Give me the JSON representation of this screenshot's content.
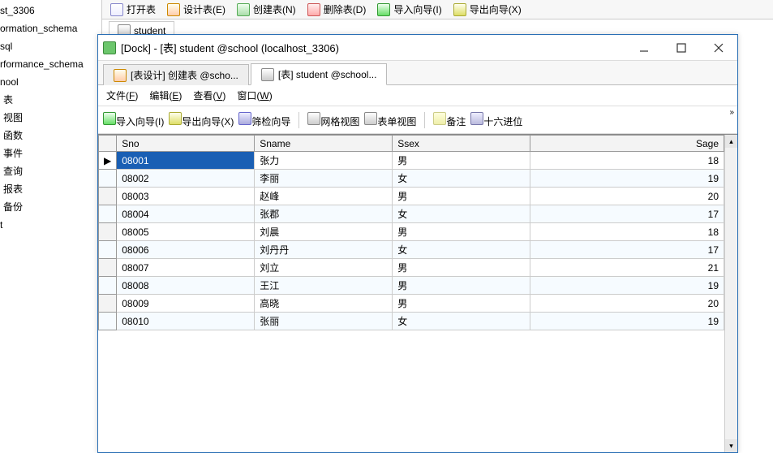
{
  "tree": {
    "items": [
      {
        "label": "st_3306",
        "lvl": 1
      },
      {
        "label": "ormation_schema",
        "lvl": 1
      },
      {
        "label": "sql",
        "lvl": 1
      },
      {
        "label": "rformance_schema",
        "lvl": 1
      },
      {
        "label": "nool",
        "lvl": 1
      },
      {
        "label": "表",
        "lvl": 2
      },
      {
        "label": "视图",
        "lvl": 2
      },
      {
        "label": "函数",
        "lvl": 2
      },
      {
        "label": "事件",
        "lvl": 2
      },
      {
        "label": "查询",
        "lvl": 2
      },
      {
        "label": "报表",
        "lvl": 2
      },
      {
        "label": "备份",
        "lvl": 2
      },
      {
        "label": "t",
        "lvl": 1
      }
    ]
  },
  "topToolbar": {
    "buttons": [
      {
        "label": "打开表",
        "icon": "doc"
      },
      {
        "label": "设计表(E)",
        "icon": "edit"
      },
      {
        "label": "创建表(N)",
        "icon": "new"
      },
      {
        "label": "删除表(D)",
        "icon": "del"
      },
      {
        "label": "导入向导(I)",
        "icon": "imp"
      },
      {
        "label": "导出向导(X)",
        "icon": "exp"
      }
    ]
  },
  "bgTab": "student",
  "window": {
    "title": "[Dock] - [表] student @school (localhost_3306)",
    "innerTabs": [
      {
        "label": "[表设计] 创建表 @scho...",
        "icon": "edit",
        "selected": false
      },
      {
        "label": "[表] student @school...",
        "icon": "grid",
        "selected": true
      }
    ],
    "menu": [
      {
        "label": "文件",
        "key": "F"
      },
      {
        "label": "编辑",
        "key": "E"
      },
      {
        "label": "查看",
        "key": "V"
      },
      {
        "label": "窗口",
        "key": "W"
      }
    ],
    "toolbar": [
      {
        "label": "导入向导(I)",
        "icon": "imp"
      },
      {
        "label": "导出向导(X)",
        "icon": "exp"
      },
      {
        "label": "筛检向导",
        "icon": "filter"
      },
      {
        "sep": true
      },
      {
        "label": "网格视图",
        "icon": "grid"
      },
      {
        "label": "表单视图",
        "icon": "grid"
      },
      {
        "sep": true
      },
      {
        "label": "备注",
        "icon": "memo"
      },
      {
        "label": "十六进位",
        "icon": "hex"
      }
    ],
    "more": "»"
  },
  "grid": {
    "columns": [
      "Sno",
      "Sname",
      "Ssex",
      "Sage"
    ],
    "rows": [
      {
        "Sno": "08001",
        "Sname": "张力",
        "Ssex": "男",
        "Sage": "18",
        "selected": true
      },
      {
        "Sno": "08002",
        "Sname": "李丽",
        "Ssex": "女",
        "Sage": "19"
      },
      {
        "Sno": "08003",
        "Sname": "赵峰",
        "Ssex": "男",
        "Sage": "20"
      },
      {
        "Sno": "08004",
        "Sname": "张郡",
        "Ssex": "女",
        "Sage": "17"
      },
      {
        "Sno": "08005",
        "Sname": "刘晨",
        "Ssex": "男",
        "Sage": "18"
      },
      {
        "Sno": "08006",
        "Sname": "刘丹丹",
        "Ssex": "女",
        "Sage": "17"
      },
      {
        "Sno": "08007",
        "Sname": "刘立",
        "Ssex": "男",
        "Sage": "21"
      },
      {
        "Sno": "08008",
        "Sname": "王江",
        "Ssex": "男",
        "Sage": "19"
      },
      {
        "Sno": "08009",
        "Sname": "高晓",
        "Ssex": "男",
        "Sage": "20"
      },
      {
        "Sno": "08010",
        "Sname": "张丽",
        "Ssex": "女",
        "Sage": "19"
      }
    ]
  }
}
